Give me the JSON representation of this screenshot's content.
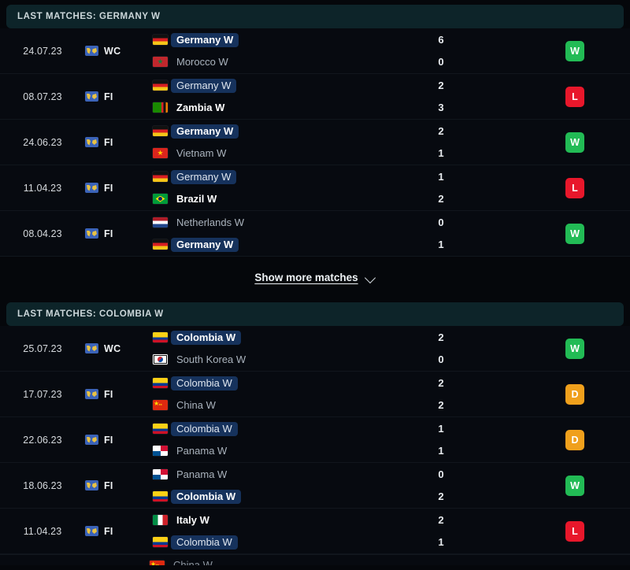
{
  "colors": {
    "page_bg": "#05070b",
    "row_bg": "#070a10",
    "header_bg": "#0d2429",
    "highlight_pill": "#16325c",
    "win": "#22bb55",
    "loss": "#e8172b",
    "draw": "#f0a01c"
  },
  "sections": [
    {
      "header": "LAST MATCHES: GERMANY W",
      "matches": [
        {
          "date": "24.07.23",
          "competition": "WC",
          "competition_icon": "world-map-icon",
          "home": {
            "name": "Germany W",
            "flag": "germany",
            "winner": true,
            "highlight": true
          },
          "away": {
            "name": "Morocco W",
            "flag": "morocco",
            "winner": false,
            "highlight": false
          },
          "home_score": "6",
          "away_score": "0",
          "result": "W"
        },
        {
          "date": "08.07.23",
          "competition": "FI",
          "competition_icon": "world-map-icon",
          "home": {
            "name": "Germany W",
            "flag": "germany",
            "winner": false,
            "highlight": true
          },
          "away": {
            "name": "Zambia W",
            "flag": "zambia",
            "winner": true,
            "highlight": false
          },
          "home_score": "2",
          "away_score": "3",
          "result": "L"
        },
        {
          "date": "24.06.23",
          "competition": "FI",
          "competition_icon": "world-map-icon",
          "home": {
            "name": "Germany W",
            "flag": "germany",
            "winner": true,
            "highlight": true
          },
          "away": {
            "name": "Vietnam W",
            "flag": "vietnam",
            "winner": false,
            "highlight": false
          },
          "home_score": "2",
          "away_score": "1",
          "result": "W"
        },
        {
          "date": "11.04.23",
          "competition": "FI",
          "competition_icon": "world-map-icon",
          "home": {
            "name": "Germany W",
            "flag": "germany",
            "winner": false,
            "highlight": true
          },
          "away": {
            "name": "Brazil W",
            "flag": "brazil",
            "winner": true,
            "highlight": false
          },
          "home_score": "1",
          "away_score": "2",
          "result": "L"
        },
        {
          "date": "08.04.23",
          "competition": "FI",
          "competition_icon": "world-map-icon",
          "home": {
            "name": "Netherlands W",
            "flag": "netherlands",
            "winner": false,
            "highlight": false
          },
          "away": {
            "name": "Germany W",
            "flag": "germany",
            "winner": true,
            "highlight": true
          },
          "home_score": "0",
          "away_score": "1",
          "result": "W"
        }
      ],
      "show_more_label": "Show more matches",
      "show_more_icon": "chevron-down-icon"
    },
    {
      "header": "LAST MATCHES: COLOMBIA W",
      "matches": [
        {
          "date": "25.07.23",
          "competition": "WC",
          "competition_icon": "world-map-icon",
          "home": {
            "name": "Colombia W",
            "flag": "colombia",
            "winner": true,
            "highlight": true
          },
          "away": {
            "name": "South Korea W",
            "flag": "southkorea",
            "winner": false,
            "highlight": false
          },
          "home_score": "2",
          "away_score": "0",
          "result": "W"
        },
        {
          "date": "17.07.23",
          "competition": "FI",
          "competition_icon": "world-map-icon",
          "home": {
            "name": "Colombia W",
            "flag": "colombia",
            "winner": false,
            "highlight": true
          },
          "away": {
            "name": "China W",
            "flag": "china",
            "winner": false,
            "highlight": false
          },
          "home_score": "2",
          "away_score": "2",
          "result": "D"
        },
        {
          "date": "22.06.23",
          "competition": "FI",
          "competition_icon": "world-map-icon",
          "home": {
            "name": "Colombia W",
            "flag": "colombia",
            "winner": false,
            "highlight": true
          },
          "away": {
            "name": "Panama W",
            "flag": "panama",
            "winner": false,
            "highlight": false
          },
          "home_score": "1",
          "away_score": "1",
          "result": "D"
        },
        {
          "date": "18.06.23",
          "competition": "FI",
          "competition_icon": "world-map-icon",
          "home": {
            "name": "Panama W",
            "flag": "panama",
            "winner": false,
            "highlight": false
          },
          "away": {
            "name": "Colombia W",
            "flag": "colombia",
            "winner": true,
            "highlight": true
          },
          "home_score": "0",
          "away_score": "2",
          "result": "W"
        },
        {
          "date": "11.04.23",
          "competition": "FI",
          "competition_icon": "world-map-icon",
          "home": {
            "name": "Italy W",
            "flag": "italy",
            "winner": true,
            "highlight": false
          },
          "away": {
            "name": "Colombia W",
            "flag": "colombia",
            "winner": false,
            "highlight": true
          },
          "home_score": "2",
          "away_score": "1",
          "result": "L"
        }
      ]
    }
  ],
  "clipped_row": {
    "team_name": "China W",
    "flag": "china"
  }
}
